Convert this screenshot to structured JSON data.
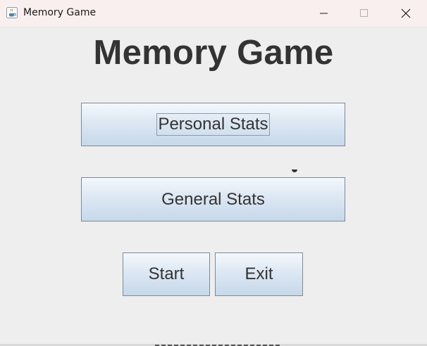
{
  "window": {
    "title": "Memory Game",
    "icon": "java-coffee-icon",
    "controls": {
      "minimize": "minimize-icon",
      "maximize": "maximize-icon",
      "close": "close-icon"
    }
  },
  "main": {
    "heading": "Memory Game",
    "buttons": {
      "personal_stats": "Personal Stats",
      "general_stats": "General Stats",
      "start": "Start",
      "exit": "Exit"
    },
    "focused_button": "Personal Stats"
  },
  "colors": {
    "background": "#eeeeee",
    "titlebar": "#f9efef",
    "text": "#333333",
    "button_border": "#7a8a99",
    "button_gradient_top": "#f4f8fc",
    "button_gradient_bottom": "#c6d8ea"
  }
}
